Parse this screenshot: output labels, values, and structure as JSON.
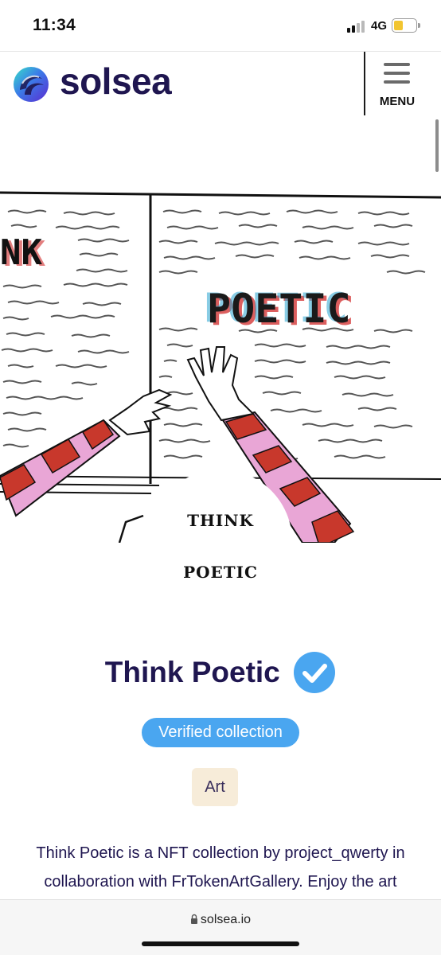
{
  "status_bar": {
    "time": "11:34",
    "network": "4G",
    "battery_level": 0.3,
    "battery_color": "#f2c530",
    "signal_bars_active": 2
  },
  "header": {
    "logo_text": "solsea",
    "logo_icon": "solsea-wave-logo",
    "menu_label": "MENU",
    "menu_icon": "hamburger-icon"
  },
  "banner": {
    "art_text_left": "NK",
    "art_text_right": "POETIC"
  },
  "avatar": {
    "line1": "THINK",
    "line2": "POETIC"
  },
  "collection": {
    "title": "Think Poetic",
    "verified_icon": "verified-check-icon",
    "verified_label": "Verified collection",
    "category": "Art",
    "description": "Think Poetic is a NFT collection by project_qwerty in collaboration with FrTokenArtGallery. Enjoy the art"
  },
  "browser": {
    "url": "solsea.io",
    "lock_icon": "lock-icon"
  },
  "colors": {
    "brand_navy": "#1f1650",
    "verified_blue": "#4aa6f0",
    "tag_background": "#f7ecd9"
  }
}
